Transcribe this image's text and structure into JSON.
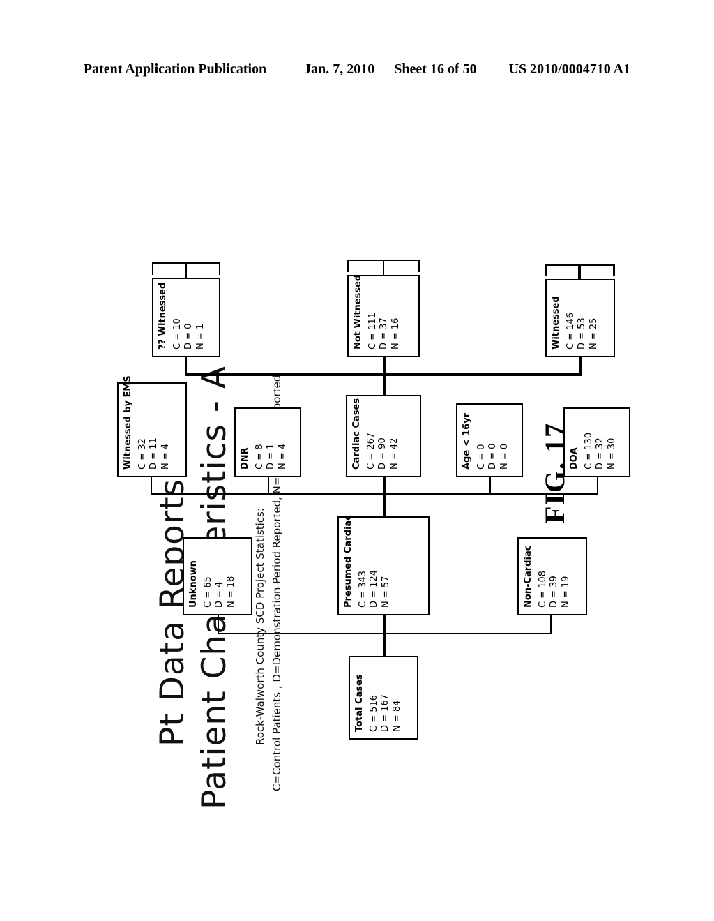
{
  "header": {
    "publication": "Patent Application Publication",
    "date": "Jan. 7, 2010",
    "sheet": "Sheet 16 of 50",
    "number": "US 2010/0004710 A1"
  },
  "figure": {
    "title_line1": "Pt Data Reports",
    "title_line2": "Patient Characteristics - A",
    "subtitle_line1": "Rock-Walworth County SCD Project Statistics:",
    "subtitle_line2": "C=Control Patients , D=Demonstration Period Reported, N=New since reported",
    "figure_number": "FIG. 17"
  },
  "chart_data": {
    "type": "diagram",
    "title": "Patient Characteristics - A",
    "subtitle": "Rock-Walworth County SCD Project Statistics",
    "legend": {
      "C": "Control Patients",
      "D": "Demonstration Period Reported",
      "N": "New since reported"
    },
    "nodes": [
      {
        "id": "total_cases",
        "label": "Total Cases",
        "c": "C = 516",
        "d": "D = 167",
        "n": "N = 84",
        "values": {
          "C": 516,
          "D": 167,
          "N": 84
        },
        "parent": null
      },
      {
        "id": "unknown",
        "label": "Unknown",
        "c": "C = 65",
        "d": "D = 4",
        "n": "N = 18",
        "values": {
          "C": 65,
          "D": 4,
          "N": 18
        },
        "parent": "total_cases"
      },
      {
        "id": "presumed_cardiac",
        "label": "Presumed Cardiac",
        "c": "C = 343",
        "d": "D = 124",
        "n": "N = 57",
        "values": {
          "C": 343,
          "D": 124,
          "N": 57
        },
        "parent": "total_cases"
      },
      {
        "id": "non_cardiac",
        "label": "Non-Cardiac",
        "c": "C = 108",
        "d": "D = 39",
        "n": "N = 19",
        "values": {
          "C": 108,
          "D": 39,
          "N": 19
        },
        "parent": "total_cases"
      },
      {
        "id": "witnessed_by_ems",
        "label": "Witnessed by EMS",
        "c": "C = 32",
        "d": "D = 11",
        "n": "N = 4",
        "values": {
          "C": 32,
          "D": 11,
          "N": 4
        },
        "parent": "presumed_cardiac"
      },
      {
        "id": "dnr",
        "label": "DNR",
        "c": "C = 8",
        "d": "D = 1",
        "n": "N = 4",
        "values": {
          "C": 8,
          "D": 1,
          "N": 4
        },
        "parent": "presumed_cardiac"
      },
      {
        "id": "cardiac_cases",
        "label": "Cardiac Cases",
        "c": "C = 267",
        "d": "D = 90",
        "n": "N = 42",
        "values": {
          "C": 267,
          "D": 90,
          "N": 42
        },
        "parent": "presumed_cardiac"
      },
      {
        "id": "age_under_16",
        "label": "Age  < 16yr",
        "c": "C = 0",
        "d": "D = 0",
        "n": "N = 0",
        "values": {
          "C": 0,
          "D": 0,
          "N": 0
        },
        "parent": "presumed_cardiac"
      },
      {
        "id": "doa",
        "label": "DOA",
        "c": "C = 130",
        "d": "D = 32",
        "n": "N = 30",
        "values": {
          "C": 130,
          "D": 32,
          "N": 30
        },
        "parent": "presumed_cardiac"
      },
      {
        "id": "qq_witnessed",
        "label": "?? Witnessed",
        "c": "C = 10",
        "d": "D = 0",
        "n": "N = 1",
        "values": {
          "C": 10,
          "D": 0,
          "N": 1
        },
        "parent": "cardiac_cases"
      },
      {
        "id": "not_witnessed",
        "label": "Not Witnessed",
        "c": "C = 111",
        "d": "D = 37",
        "n": "N = 16",
        "values": {
          "C": 111,
          "D": 37,
          "N": 16
        },
        "parent": "cardiac_cases"
      },
      {
        "id": "witnessed",
        "label": "Witnessed",
        "c": "C = 146",
        "d": "D = 53",
        "n": "N = 25",
        "values": {
          "C": 146,
          "D": 53,
          "N": 25
        },
        "parent": "cardiac_cases"
      }
    ]
  }
}
